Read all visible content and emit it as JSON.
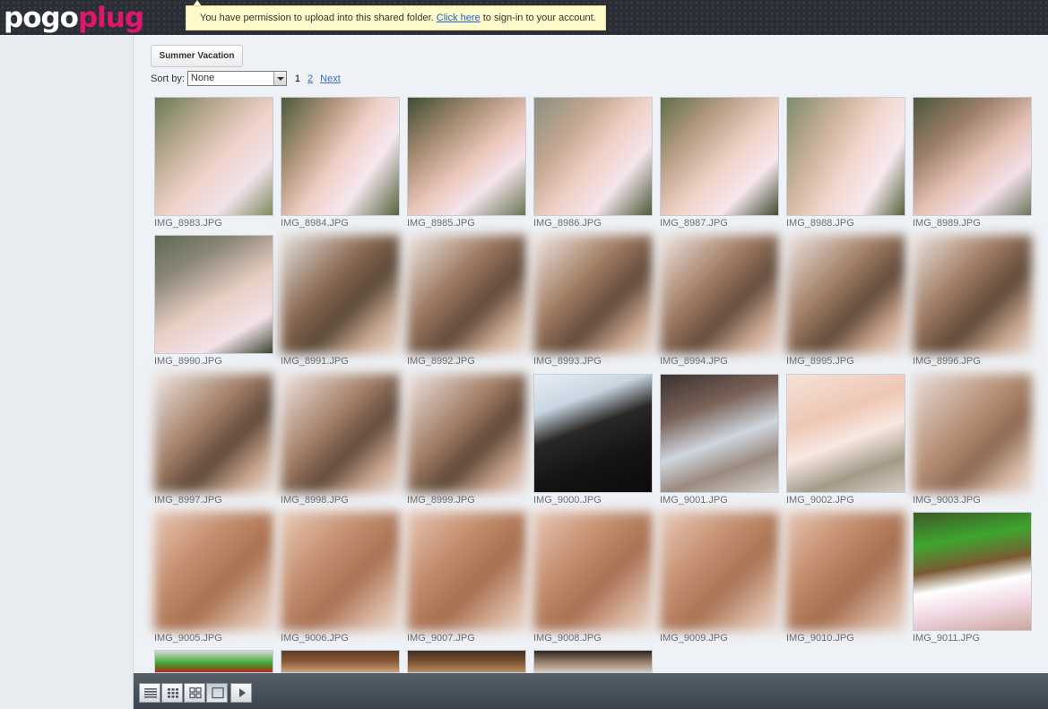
{
  "header": {
    "logo_part1": "pogo",
    "logo_part2": "plug",
    "notice_prefix": "You have permission to upload into this shared folder.",
    "notice_link": "Click here",
    "notice_suffix": "to sign-in to your account."
  },
  "folder": {
    "name": "Summer Vacation"
  },
  "sort": {
    "label": "Sort by:",
    "value": "None"
  },
  "pager": {
    "current": "1",
    "page2": "2",
    "next": "Next"
  },
  "photos": [
    {
      "name": "IMG_8983.JPG"
    },
    {
      "name": "IMG_8984.JPG"
    },
    {
      "name": "IMG_8985.JPG"
    },
    {
      "name": "IMG_8986.JPG"
    },
    {
      "name": "IMG_8987.JPG"
    },
    {
      "name": "IMG_8988.JPG"
    },
    {
      "name": "IMG_8989.JPG"
    },
    {
      "name": "IMG_8990.JPG"
    },
    {
      "name": "IMG_8991.JPG"
    },
    {
      "name": "IMG_8992.JPG"
    },
    {
      "name": "IMG_8993.JPG"
    },
    {
      "name": "IMG_8994.JPG"
    },
    {
      "name": "IMG_8995.JPG"
    },
    {
      "name": "IMG_8996.JPG"
    },
    {
      "name": "IMG_8997.JPG"
    },
    {
      "name": "IMG_8998.JPG"
    },
    {
      "name": "IMG_8999.JPG"
    },
    {
      "name": "IMG_9000.JPG"
    },
    {
      "name": "IMG_9001.JPG"
    },
    {
      "name": "IMG_9002.JPG"
    },
    {
      "name": "IMG_9003.JPG"
    },
    {
      "name": "IMG_9005.JPG"
    },
    {
      "name": "IMG_9006.JPG"
    },
    {
      "name": "IMG_9007.JPG"
    },
    {
      "name": "IMG_9008.JPG"
    },
    {
      "name": "IMG_9009.JPG"
    },
    {
      "name": "IMG_9010.JPG"
    },
    {
      "name": "IMG_9011.JPG"
    }
  ],
  "toolbar": {
    "buttons": [
      "list-view-icon",
      "small-grid-icon",
      "large-grid-icon",
      "single-view-icon",
      "slideshow-play-icon"
    ]
  },
  "colors": {
    "brand_pink": "#e0156e",
    "header_bg": "#2b2f35",
    "link": "#3a6fc4"
  }
}
